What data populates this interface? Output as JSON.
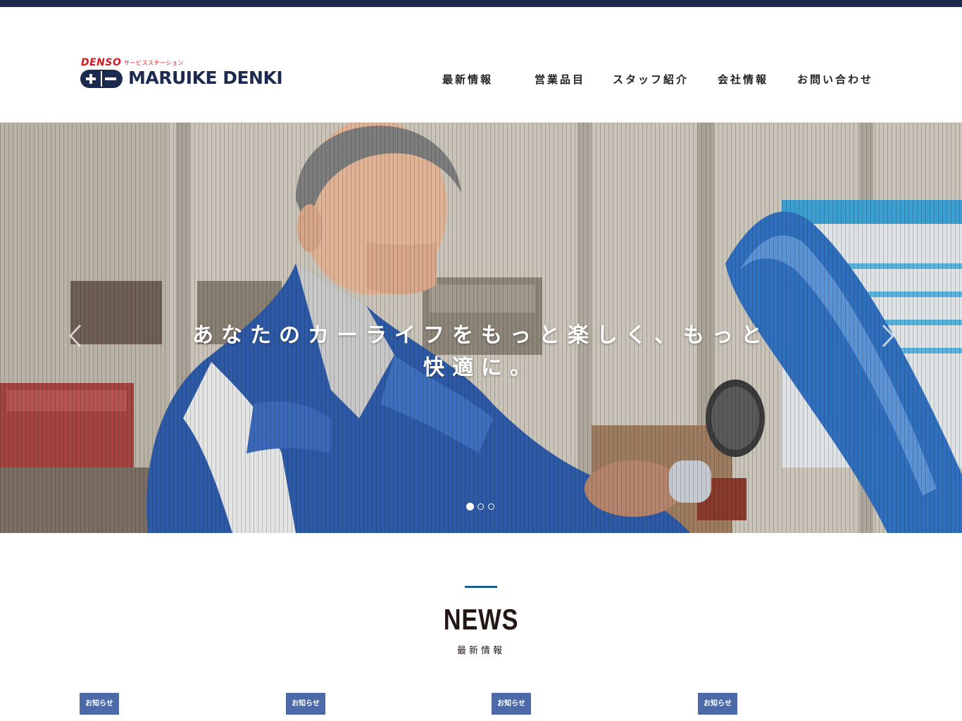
{
  "header": {
    "logo": {
      "brand_top": "DENSO",
      "brand_sub": "サービスステーション",
      "name": "MARUIKE DENKI"
    },
    "nav": [
      {
        "label": "最新情報"
      },
      {
        "label": "営業品目"
      },
      {
        "label": "スタッフ紹介"
      },
      {
        "label": "会社情報"
      },
      {
        "label": "お問い合わせ"
      }
    ]
  },
  "hero": {
    "caption": "あなたのカーライフをもっと楽しく、もっと快適に。",
    "slide_count": 3,
    "active_slide": 1
  },
  "news": {
    "title": "NEWS",
    "subtitle": "最新情報",
    "items": [
      {
        "category": "お知らせ"
      },
      {
        "category": "お知らせ"
      },
      {
        "category": "お知らせ"
      },
      {
        "category": "お知らせ"
      }
    ]
  },
  "colors": {
    "top_bar": "#1c2a4f",
    "brand_navy": "#1c2a4f",
    "denso_red": "#d5171f",
    "badge": "#4d6aa8",
    "news_rule": "#1e5e8a"
  }
}
